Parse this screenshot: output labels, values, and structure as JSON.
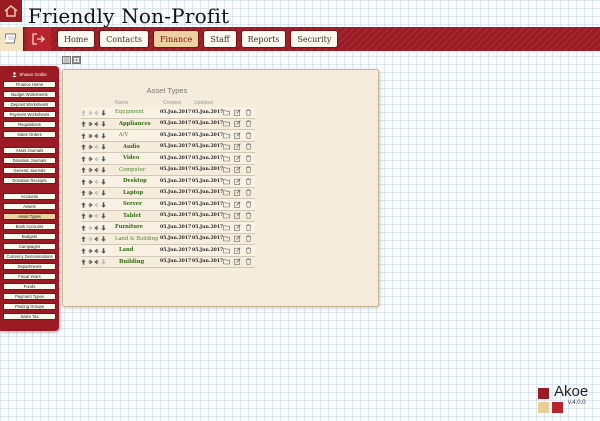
{
  "app": {
    "title": "Friendly Non-Profit"
  },
  "nav": {
    "tabs": [
      {
        "label": "Home",
        "active": false
      },
      {
        "label": "Contacts",
        "active": false
      },
      {
        "label": "Finance",
        "active": true
      },
      {
        "label": "Staff",
        "active": false
      },
      {
        "label": "Reports",
        "active": false
      },
      {
        "label": "Security",
        "active": false
      }
    ]
  },
  "sidebar": {
    "user": "Shawn Goble",
    "group1": [
      "Finance Home",
      "Budget Worksheets",
      "Deposit Worksheets",
      "Payment Worksheets",
      "Requisitions",
      "Sales Orders"
    ],
    "group2": [
      "Asset Journals",
      "Donation Journals",
      "General Journals",
      "Donation Receipts"
    ],
    "group3": [
      "Accounts",
      "Assets",
      "Asset Types",
      "Bank Accounts",
      "Budgets",
      "Campaigns",
      "Currency Denominations",
      "Departments",
      "Fiscal Years",
      "Funds",
      "Payment Types",
      "Posting Groups",
      "Sales Tax"
    ],
    "active": "Asset Types"
  },
  "panel": {
    "title": "Asset Types",
    "columns": {
      "name": "Name",
      "created": "Created",
      "updated": "Updated"
    },
    "rows": [
      {
        "name": "Equipment",
        "created": "05.Jun.2017",
        "updated": "05.Jun.2017",
        "indent": 0,
        "bold": false
      },
      {
        "name": "Appliances",
        "created": "05.Jun.2017",
        "updated": "05.Jun.2017",
        "indent": 1,
        "bold": true
      },
      {
        "name": "A/V",
        "created": "05.Jun.2017",
        "updated": "05.Jun.2017",
        "indent": 1,
        "bold": false
      },
      {
        "name": "Audio",
        "created": "05.Jun.2017",
        "updated": "05.Jun.2017",
        "indent": 2,
        "bold": true
      },
      {
        "name": "Video",
        "created": "05.Jun.2017",
        "updated": "05.Jun.2017",
        "indent": 2,
        "bold": true
      },
      {
        "name": "Computer",
        "created": "05.Jun.2017",
        "updated": "05.Jun.2017",
        "indent": 1,
        "bold": false
      },
      {
        "name": "Desktop",
        "created": "05.Jun.2017",
        "updated": "05.Jun.2017",
        "indent": 2,
        "bold": true
      },
      {
        "name": "Laptop",
        "created": "05.Jun.2017",
        "updated": "05.Jun.2017",
        "indent": 2,
        "bold": true
      },
      {
        "name": "Server",
        "created": "05.Jun.2017",
        "updated": "05.Jun.2017",
        "indent": 2,
        "bold": true
      },
      {
        "name": "Tablet",
        "created": "05.Jun.2017",
        "updated": "05.Jun.2017",
        "indent": 2,
        "bold": true
      },
      {
        "name": "Furniture",
        "created": "05.Jun.2017",
        "updated": "05.Jun.2017",
        "indent": 0,
        "bold": true
      },
      {
        "name": "Land & Building",
        "created": "05.Jun.2017",
        "updated": "05.Jun.2017",
        "indent": 0,
        "bold": false
      },
      {
        "name": "Land",
        "created": "05.Jun.2017",
        "updated": "05.Jun.2017",
        "indent": 1,
        "bold": true
      },
      {
        "name": "Building",
        "created": "05.Jun.2017",
        "updated": "05.Jun.2017",
        "indent": 1,
        "bold": true
      }
    ]
  },
  "brand": {
    "name": "Akoe",
    "version": "v.4.0.0",
    "colors": {
      "dark_red": "#9b1b24",
      "red": "#b8242d",
      "tan": "#e8cf95"
    }
  },
  "colors": {
    "accent": "#9b1b24",
    "tab_active_bg": "#ecd2a0",
    "link_green": "#3d7a1e",
    "panel_bg": "#f6ecdb"
  }
}
